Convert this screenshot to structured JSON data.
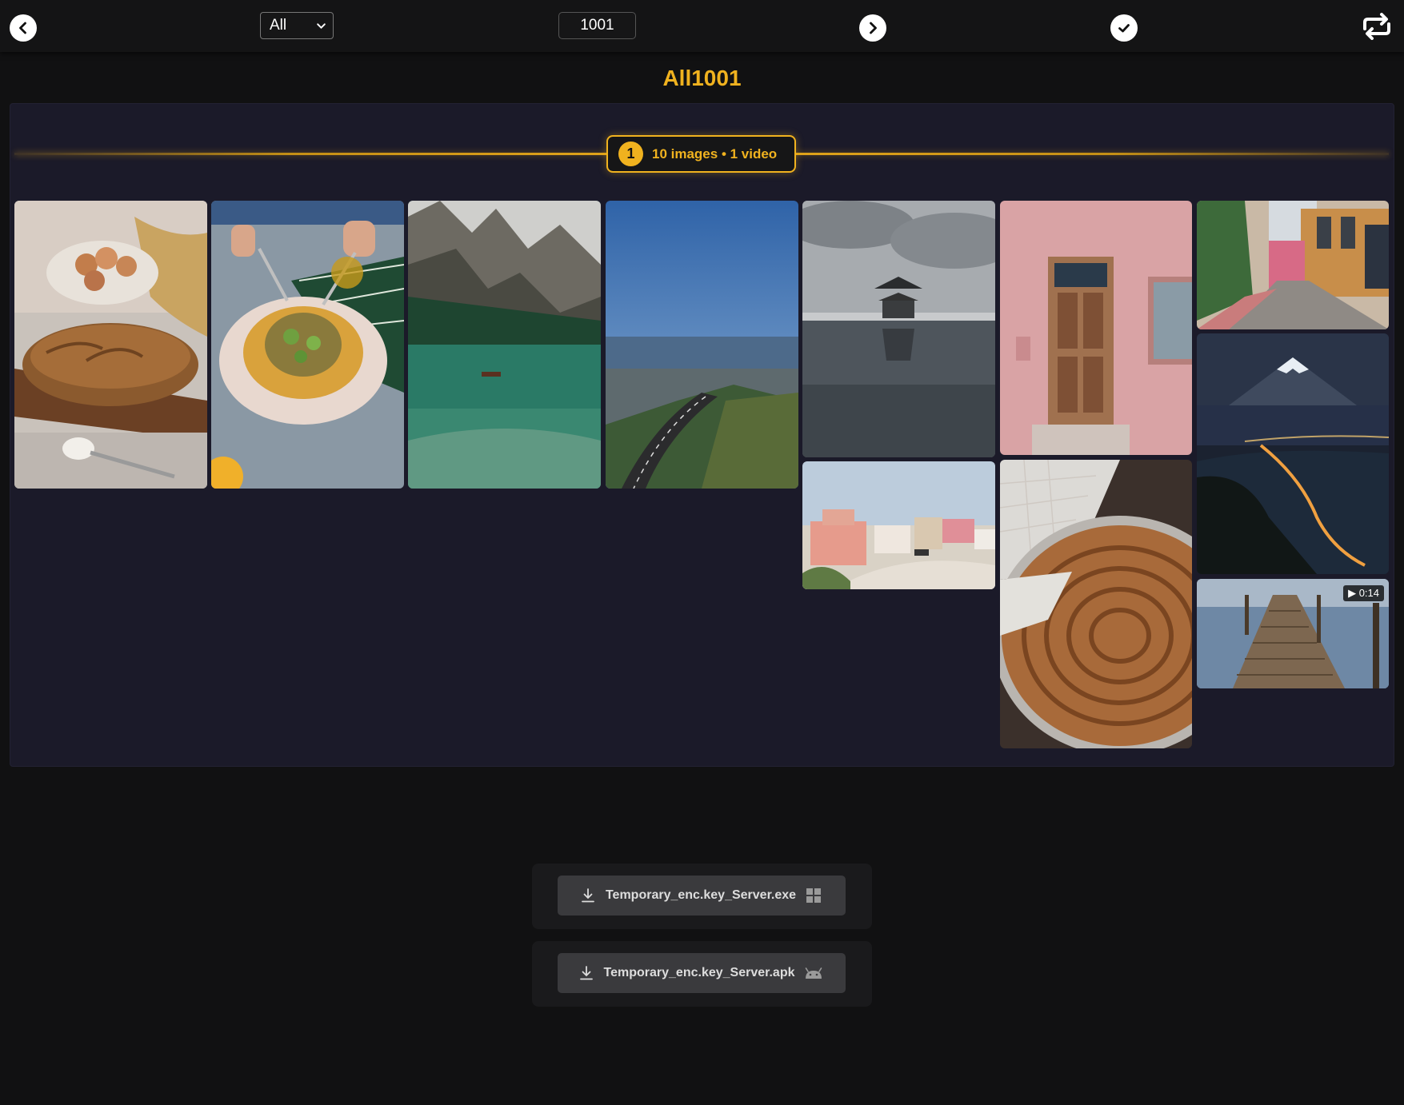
{
  "toolbar": {
    "filter_value": "All",
    "number_value": "1001"
  },
  "page": {
    "title": "All1001"
  },
  "group": {
    "index": "1",
    "summary": "10 images • 1 video"
  },
  "gallery": {
    "items": [
      {
        "subject": "bread loaf with eggs"
      },
      {
        "subject": "artichoke dish"
      },
      {
        "subject": "mountain lake"
      },
      {
        "subject": "coastal road"
      },
      {
        "subject": "pagoda on water"
      },
      {
        "subject": "pink wall with door"
      },
      {
        "subject": "street with shops"
      },
      {
        "subject": "pink houses"
      },
      {
        "subject": "spiral pastry"
      },
      {
        "subject": "mount fuji night"
      },
      {
        "subject": "wooden pier",
        "duration": "▶ 0:14"
      }
    ]
  },
  "downloads": [
    {
      "label": "Temporary_enc.key_Server.exe",
      "platform": "windows-icon"
    },
    {
      "label": "Temporary_enc.key_Server.apk",
      "platform": "android-icon"
    }
  ],
  "colors": {
    "accent": "#f0b21f",
    "background": "#111112",
    "panel": "#1b1a29"
  }
}
